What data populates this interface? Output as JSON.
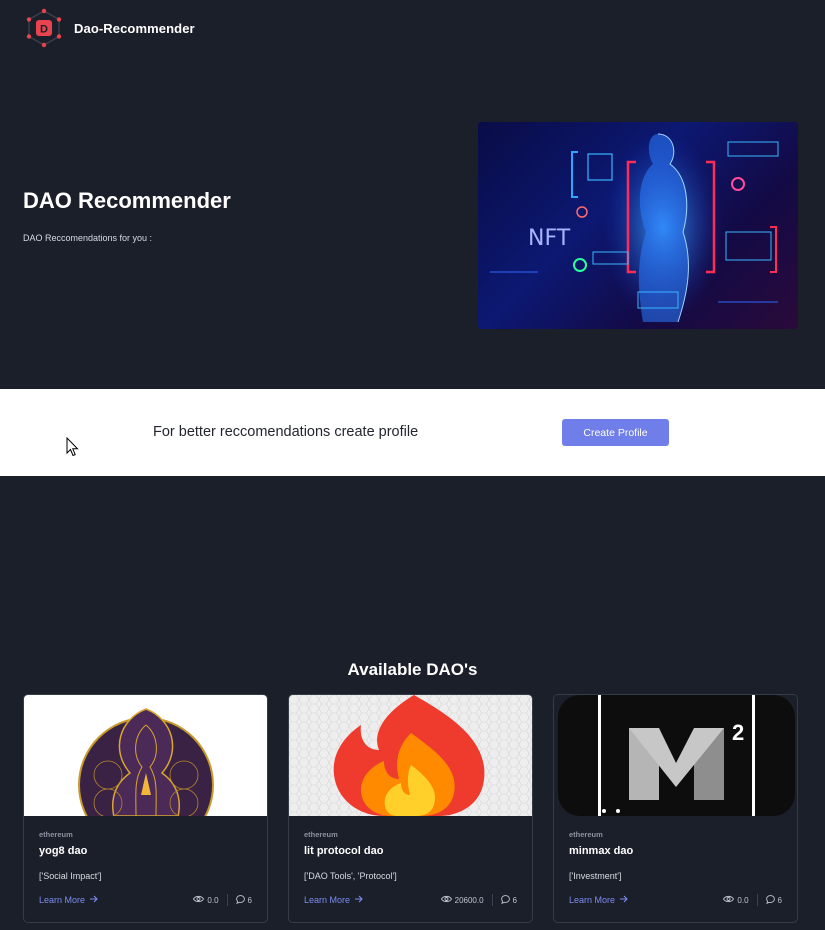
{
  "nav": {
    "brand": "Dao-Recommender",
    "logo_letter": "D"
  },
  "hero": {
    "title": "DAO Recommender",
    "subtitle": "DAO Reccomendations for you :",
    "image_label": "NFT"
  },
  "profile_band": {
    "text": "For better reccomendations create profile",
    "button_label": "Create Profile"
  },
  "section": {
    "title": "Available DAO's"
  },
  "cards": [
    {
      "chain": "ethereum",
      "name": "yog8 dao",
      "categories": "['Social Impact']",
      "learn_more": "Learn More",
      "views": "0.0",
      "comments": "6"
    },
    {
      "chain": "ethereum",
      "name": "lit protocol dao",
      "categories": "['DAO Tools', 'Protocol']",
      "learn_more": "Learn More",
      "views": "20600.0",
      "comments": "6"
    },
    {
      "chain": "ethereum",
      "name": "minmax dao",
      "categories": "['Investment']",
      "learn_more": "Learn More",
      "views": "0.0",
      "comments": "6",
      "image_text": "M",
      "image_sup": "2"
    }
  ],
  "colors": {
    "background": "#1b1f29",
    "accent": "#6f7ee8",
    "link": "#7e8cf0",
    "logo": "#e8434f"
  },
  "icons": [
    "logo-icon",
    "arrow-right-icon",
    "eye-icon",
    "comment-icon",
    "cursor-icon"
  ]
}
